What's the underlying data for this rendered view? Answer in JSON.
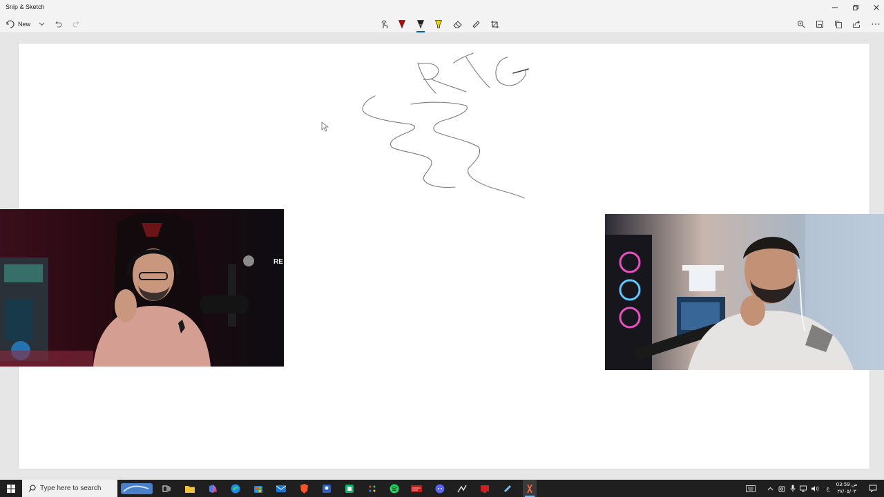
{
  "window": {
    "title": "Snip & Sketch",
    "controls": [
      "minimize-icon",
      "restore-icon",
      "close-icon"
    ]
  },
  "toolbar": {
    "new_label": "New",
    "left_icons": [
      "new-icon",
      "chevron-down-icon",
      "undo-icon",
      "redo-icon"
    ],
    "tools": [
      "touch-writing-icon",
      "ballpoint-pen-icon",
      "pencil-icon",
      "highlighter-icon",
      "eraser-icon",
      "ruler-icon",
      "crop-icon"
    ],
    "selected_tool": "pencil-icon",
    "pen_colors": {
      "ballpoint": "#c00000",
      "pencil": "#222222",
      "highlighter": "#f2d600"
    },
    "right_icons": [
      "zoom-icon",
      "save-icon",
      "copy-icon",
      "share-icon",
      "more-icon"
    ]
  },
  "canvas": {
    "handwriting": "RTG",
    "ink_color": "#777777"
  },
  "webcams": [
    {
      "name": "left-webcam",
      "overlay_text": "RE"
    },
    {
      "name": "right-webcam"
    }
  ],
  "taskbar": {
    "search_placeholder": "Type here to search",
    "apps": [
      "start-icon",
      "search-icon",
      "news-icon",
      "task-view-icon",
      "file-explorer-icon",
      "copilot-icon",
      "edge-icon",
      "store-icon",
      "mail-icon",
      "brave-icon",
      "app-icon",
      "app-icon",
      "app-icon",
      "spotify-icon",
      "app-icon",
      "app-icon",
      "app-icon",
      "app-icon",
      "app-icon",
      "snip-sketch-icon"
    ],
    "tray": {
      "language": "ع",
      "time": "03:59 ص",
      "date": "٢٧/٠٥/٠٣"
    }
  }
}
